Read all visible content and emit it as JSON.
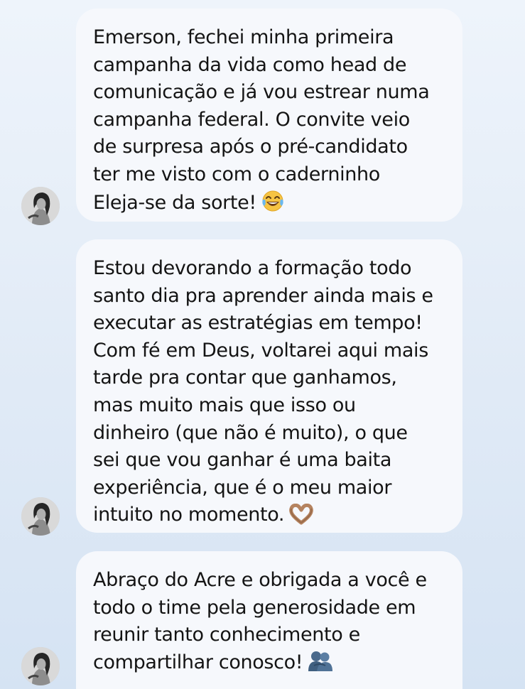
{
  "messages": [
    {
      "lines": [
        "Emerson, fechei minha primeira",
        "campanha da vida como head de",
        "comunicação e já vou estrear numa",
        "campanha federal. O convite veio",
        "de surpresa após o pré-candidato",
        "ter me visto com o caderninho",
        "Eleja-se da sorte!"
      ],
      "emoji": "tears-of-joy-emoji"
    },
    {
      "lines": [
        "Estou devorando a formação todo",
        "santo dia pra aprender ainda mais e",
        "executar as estratégias em tempo!",
        "Com fé em Deus, voltarei aqui mais",
        "tarde pra contar que ganhamos,",
        "mas muito mais que isso ou",
        "dinheiro (que não é muito), o que",
        "sei que vou ganhar é uma baita",
        "experiência, que é o meu maior",
        "intuito no momento."
      ],
      "emoji": "heart-hands-emoji"
    },
    {
      "lines": [
        "Abraço do Acre e obrigada a você e",
        "todo o time pela generosidade em",
        "reunir tanto conhecimento e",
        "compartilhar conosco!"
      ],
      "emoji": "people-hugging-emoji"
    }
  ],
  "colors": {
    "background_top": "#eef4fb",
    "background_bottom": "#d5e3f3",
    "bubble": "#f6f8fc",
    "text": "#141414"
  }
}
